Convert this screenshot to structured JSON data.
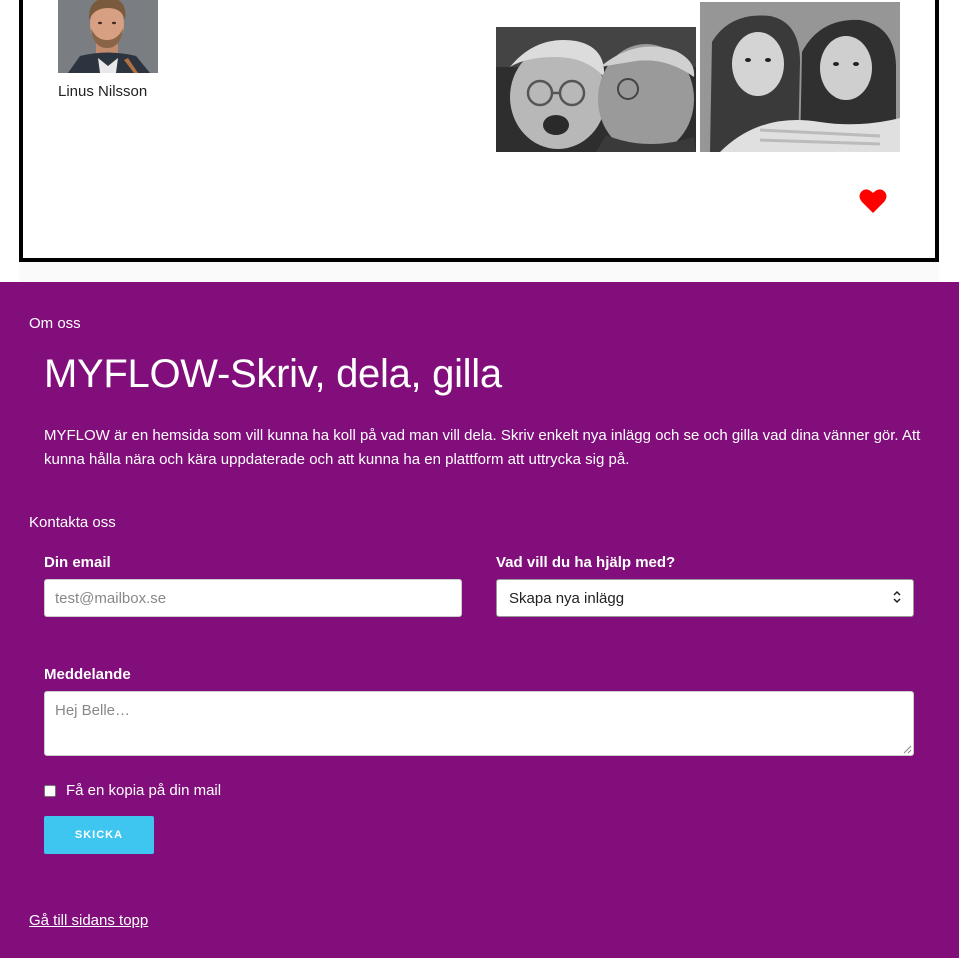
{
  "post": {
    "author_name": "Linus Nilsson",
    "heart_color": "#ff0000"
  },
  "footer": {
    "background": "#810e7b",
    "about_label": "Om oss",
    "site_title": "MYFLOW-Skriv, dela, gilla",
    "about_text": "MYFLOW är en hemsida som vill kunna ha koll på vad man vill dela. Skriv enkelt nya inlägg och se och gilla vad dina vänner gör. Att kunna hålla nära och kära uppdaterade och att kunna ha en plattform att uttrycka sig på.",
    "contact_label": "Kontakta oss",
    "form": {
      "email_label": "Din email",
      "email_placeholder": "test@mailbox.se",
      "help_label": "Vad vill du ha hjälp med?",
      "help_selected": "Skapa nya inlägg",
      "message_label": "Meddelande",
      "message_placeholder": "Hej Belle…",
      "copy_label": "Få en kopia på din mail",
      "submit_label": "SKICKA",
      "submit_color": "#3ec6f0"
    },
    "top_link": "Gå till sidans topp"
  }
}
